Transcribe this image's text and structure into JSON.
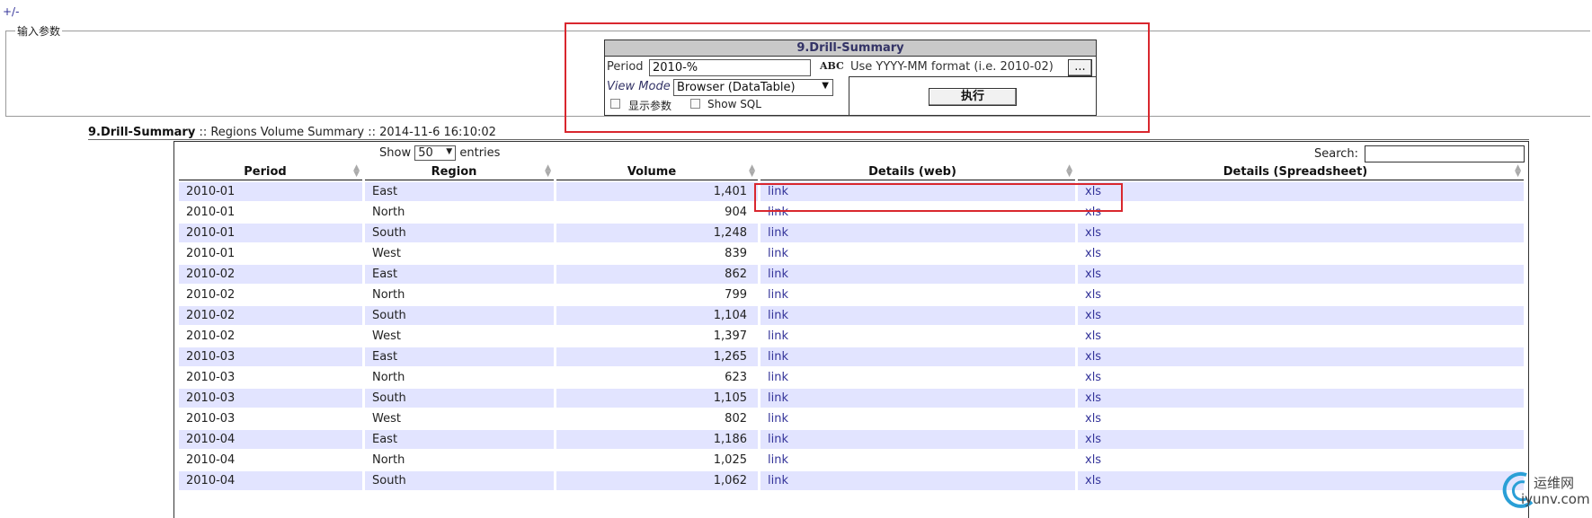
{
  "toggle_label": "+/-",
  "params": {
    "legend": "输入参数",
    "form": {
      "title": "9.Drill-Summary",
      "period_label": "Period",
      "period_value": "2010-%",
      "abc_label": "ABC",
      "format_hint": "Use YYYY-MM format (i.e. 2010-02)",
      "picker_label": "...",
      "view_mode_label": "View Mode",
      "view_mode_value": "Browser (DataTable)",
      "show_params_label": "显示参数",
      "show_sql_label": "Show SQL",
      "run_label": "执行"
    }
  },
  "report": {
    "title": "9.Drill-Summary",
    "subtitle": ":: Regions Volume Summary :: 2014-11-6 16:10:02"
  },
  "datatable": {
    "show_label": "Show",
    "page_size": "50",
    "entries_label": "entries",
    "search_label": "Search:",
    "columns": [
      "Period",
      "Region",
      "Volume",
      "Details (web)",
      "Details (Spreadsheet)"
    ],
    "rows": [
      {
        "period": "2010-01",
        "region": "East",
        "volume": "1,401",
        "web": "link",
        "xls": "xls"
      },
      {
        "period": "2010-01",
        "region": "North",
        "volume": "904",
        "web": "link",
        "xls": "xls"
      },
      {
        "period": "2010-01",
        "region": "South",
        "volume": "1,248",
        "web": "link",
        "xls": "xls"
      },
      {
        "period": "2010-01",
        "region": "West",
        "volume": "839",
        "web": "link",
        "xls": "xls"
      },
      {
        "period": "2010-02",
        "region": "East",
        "volume": "862",
        "web": "link",
        "xls": "xls"
      },
      {
        "period": "2010-02",
        "region": "North",
        "volume": "799",
        "web": "link",
        "xls": "xls"
      },
      {
        "period": "2010-02",
        "region": "South",
        "volume": "1,104",
        "web": "link",
        "xls": "xls"
      },
      {
        "period": "2010-02",
        "region": "West",
        "volume": "1,397",
        "web": "link",
        "xls": "xls"
      },
      {
        "period": "2010-03",
        "region": "East",
        "volume": "1,265",
        "web": "link",
        "xls": "xls"
      },
      {
        "period": "2010-03",
        "region": "North",
        "volume": "623",
        "web": "link",
        "xls": "xls"
      },
      {
        "period": "2010-03",
        "region": "South",
        "volume": "1,105",
        "web": "link",
        "xls": "xls"
      },
      {
        "period": "2010-03",
        "region": "West",
        "volume": "802",
        "web": "link",
        "xls": "xls"
      },
      {
        "period": "2010-04",
        "region": "East",
        "volume": "1,186",
        "web": "link",
        "xls": "xls"
      },
      {
        "period": "2010-04",
        "region": "North",
        "volume": "1,025",
        "web": "link",
        "xls": "xls"
      },
      {
        "period": "2010-04",
        "region": "South",
        "volume": "1,062",
        "web": "link",
        "xls": "xls"
      }
    ]
  },
  "watermark": {
    "line1": "运维网",
    "line2": "iyunv.com"
  },
  "colors": {
    "highlight": "#d9272e",
    "row_alt": "#e2e4ff",
    "link": "#333399"
  }
}
